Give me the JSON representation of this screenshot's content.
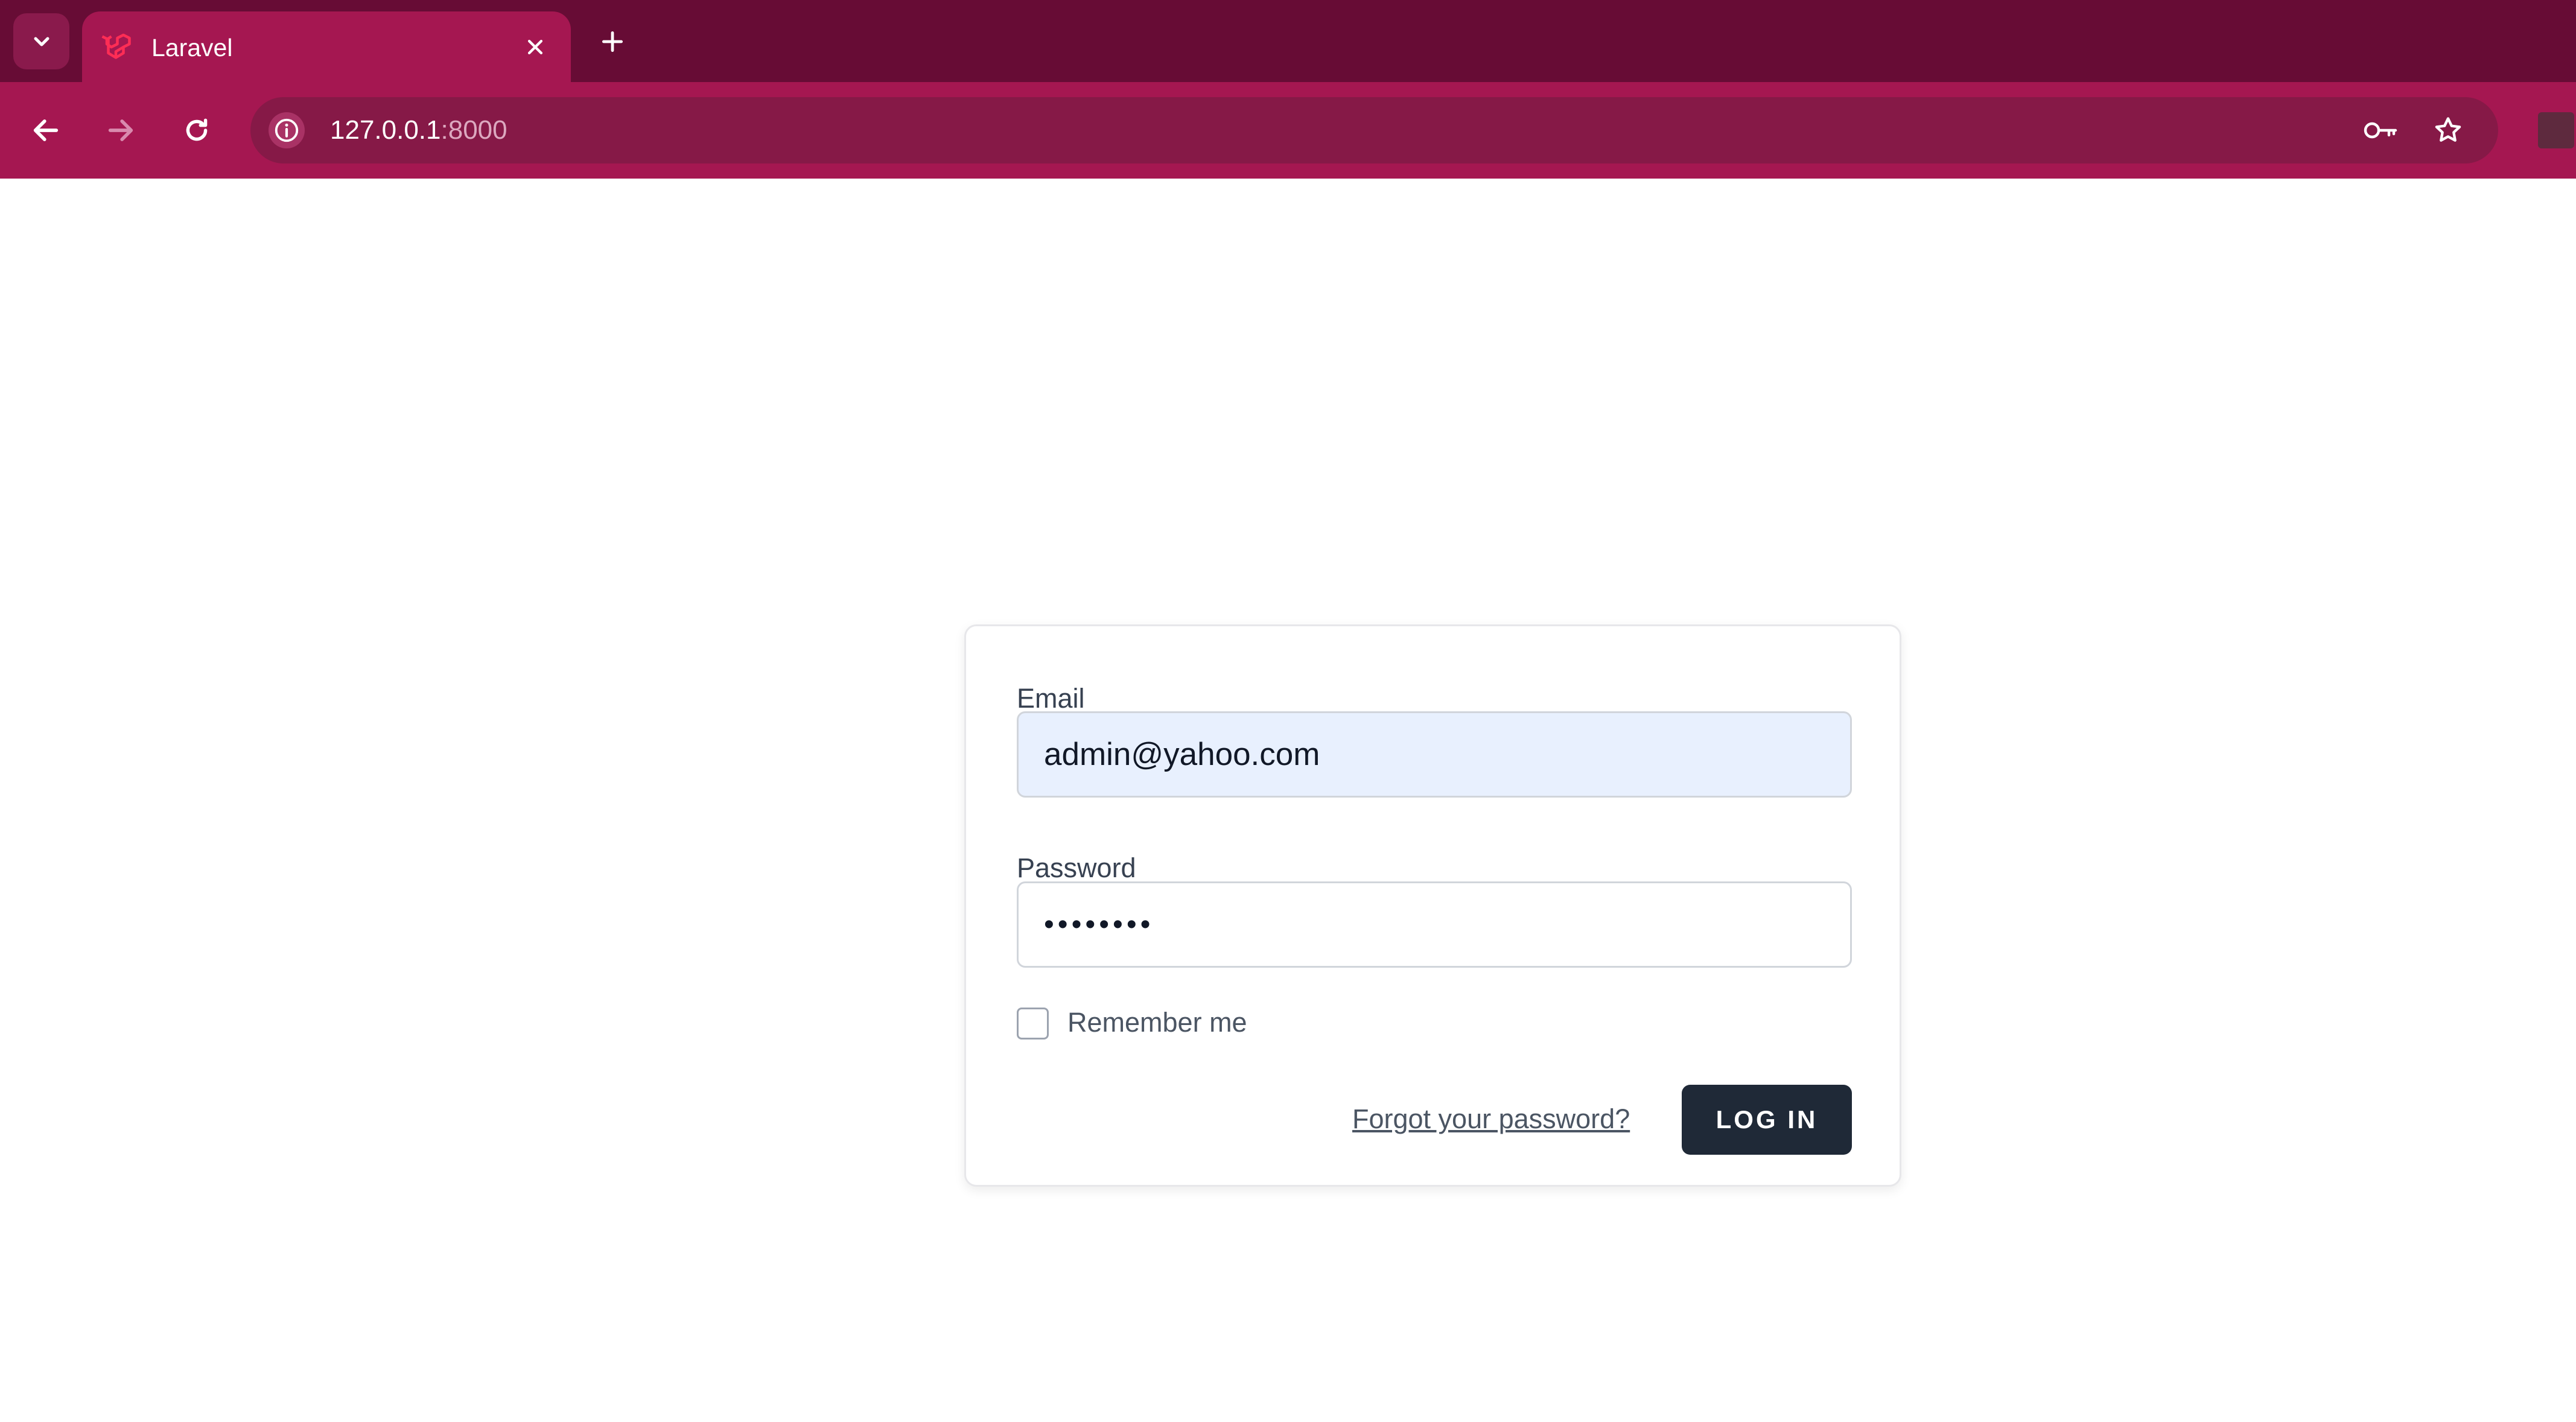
{
  "browser": {
    "tab": {
      "title": "Laravel",
      "favicon": "laravel-logo-icon"
    },
    "address_bar": {
      "host": "127.0.0.1",
      "port": ":8000"
    },
    "icons": {
      "tab_search": "chevron-down-icon",
      "tab_close": "close-icon",
      "new_tab": "plus-icon",
      "back": "arrow-left-icon",
      "forward": "arrow-right-icon",
      "reload": "reload-icon",
      "site_info": "info-icon",
      "passwords": "key-icon",
      "bookmark": "star-icon"
    },
    "colors": {
      "tabstrip": "#670c35",
      "toolbar": "#a51751",
      "omnibox": "#861947"
    }
  },
  "login_form": {
    "email": {
      "label": "Email",
      "value": "admin@yahoo.com"
    },
    "password": {
      "label": "Password",
      "masked_value": "••••••••"
    },
    "remember": {
      "label": "Remember me",
      "checked": false
    },
    "forgot_link": "Forgot your password?",
    "submit_label": "LOG IN",
    "colors": {
      "button": "#1f2937",
      "autofill": "#e8f0fe"
    }
  }
}
